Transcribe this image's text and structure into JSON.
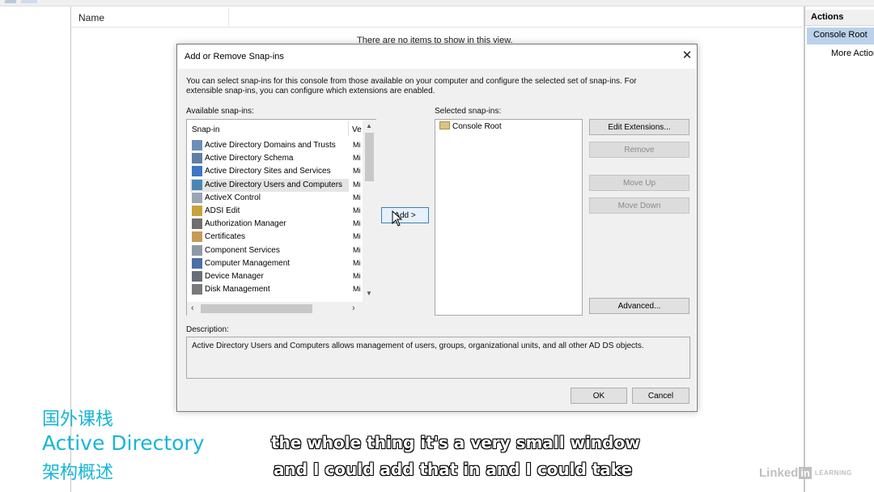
{
  "console": {
    "name_column": "Name",
    "empty_message": "There are no items to show in this view.",
    "actions_header": "Actions",
    "actions_selected": "Console Root",
    "actions_more": "More Actions"
  },
  "dialog": {
    "title": "Add or Remove Snap-ins",
    "close_glyph": "✕",
    "intro": "You can select snap-ins for this console from those available on your computer and configure the selected set of snap-ins. For extensible snap-ins, you can configure which extensions are enabled.",
    "available_label": "Available snap-ins:",
    "selected_label": "Selected snap-ins:",
    "columns": {
      "snapin": "Snap-in",
      "vendor": "Ve"
    },
    "snapins": [
      {
        "name": "Active Directory Domains and Trusts",
        "vendor": "Mi",
        "icon": "ad-domains-icon"
      },
      {
        "name": "Active Directory Schema",
        "vendor": "Mi",
        "icon": "ad-schema-icon"
      },
      {
        "name": "Active Directory Sites and Services",
        "vendor": "Mi",
        "icon": "ad-sites-icon"
      },
      {
        "name": "Active Directory Users and Computers",
        "vendor": "Mi",
        "icon": "ad-users-icon",
        "selected": true
      },
      {
        "name": "ActiveX Control",
        "vendor": "Mi",
        "icon": "activex-icon"
      },
      {
        "name": "ADSI Edit",
        "vendor": "Mi",
        "icon": "adsi-edit-icon"
      },
      {
        "name": "Authorization Manager",
        "vendor": "Mi",
        "icon": "authorization-icon"
      },
      {
        "name": "Certificates",
        "vendor": "Mi",
        "icon": "certificates-icon"
      },
      {
        "name": "Component Services",
        "vendor": "Mi",
        "icon": "component-services-icon"
      },
      {
        "name": "Computer Management",
        "vendor": "Mi",
        "icon": "computer-management-icon"
      },
      {
        "name": "Device Manager",
        "vendor": "Mi",
        "icon": "device-manager-icon"
      },
      {
        "name": "Disk Management",
        "vendor": "Mi",
        "icon": "disk-management-icon"
      }
    ],
    "add_button": "Add >",
    "selected_items": [
      "Console Root"
    ],
    "buttons": {
      "edit_extensions": "Edit Extensions...",
      "remove": "Remove",
      "move_up": "Move Up",
      "move_down": "Move Down",
      "advanced": "Advanced..."
    },
    "description_label": "Description:",
    "description": "Active Directory Users and Computers allows management of users, groups, organizational units, and all other AD DS objects.",
    "ok": "OK",
    "cancel": "Cancel"
  },
  "overlay": {
    "watermark_line1": "国外课栈",
    "watermark_line2": "Active Directory",
    "watermark_line3": "架构概述",
    "subtitle_line1": "the whole thing it's a very small window",
    "subtitle_line2": "and I could add that in and I could take",
    "logo_text": "Linked",
    "logo_in": "in",
    "logo_sub": "LEARNING"
  },
  "colors": {
    "accent": "#bcd1ea",
    "watermark": "#18b5d6",
    "dialog_bg": "#f0f0f0"
  }
}
